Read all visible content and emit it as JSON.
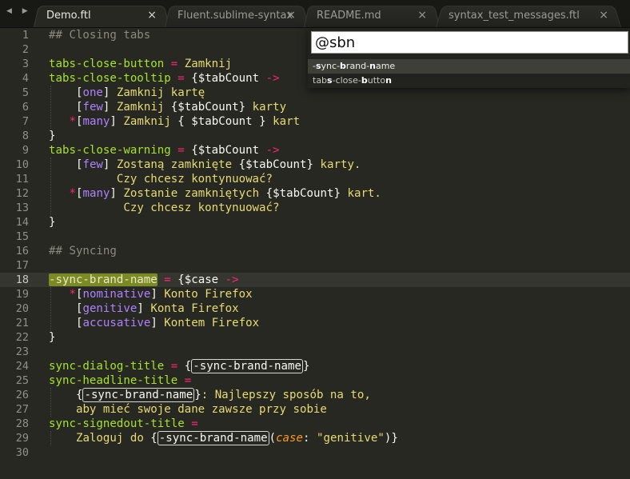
{
  "nav": {
    "arrows": "◀ ▶"
  },
  "tabs": [
    {
      "label": "Demo.ftl",
      "close": "×",
      "active": true
    },
    {
      "label": "Fluent.sublime-syntax",
      "close": "×",
      "active": false
    },
    {
      "label": "README.md",
      "close": "×",
      "active": false
    },
    {
      "label": "syntax_test_messages.ftl",
      "close": "×",
      "active": false
    }
  ],
  "editor": {
    "current_line": 18,
    "line_numbers": [
      "1",
      "2",
      "3",
      "4",
      "5",
      "6",
      "7",
      "8",
      "9",
      "10",
      "11",
      "12",
      "13",
      "14",
      "15",
      "16",
      "17",
      "18",
      "19",
      "20",
      "21",
      "22",
      "23",
      "24",
      "25",
      "26",
      "27",
      "28",
      "29",
      "30"
    ],
    "lines": [
      [
        [
          "c-com",
          "## Closing tabs"
        ]
      ],
      [],
      [
        [
          "c-id",
          "tabs-close-button"
        ],
        [
          "c-op",
          " = "
        ],
        [
          "c-str",
          "Zamknij"
        ]
      ],
      [
        [
          "c-id",
          "tabs-close-tooltip"
        ],
        [
          "c-op",
          " = "
        ],
        [
          "c-br",
          "{"
        ],
        [
          "c-var",
          "$tabCount"
        ],
        [
          "c-op",
          " ->"
        ]
      ],
      [
        [
          "",
          "    "
        ],
        [
          "c-br",
          "["
        ],
        [
          "c-key",
          "one"
        ],
        [
          "c-br",
          "]"
        ],
        [
          "c-str",
          " Zamknij kartę"
        ]
      ],
      [
        [
          "",
          "    "
        ],
        [
          "c-br",
          "["
        ],
        [
          "c-key",
          "few"
        ],
        [
          "c-br",
          "]"
        ],
        [
          "c-str",
          " Zamknij "
        ],
        [
          "c-br",
          "{"
        ],
        [
          "c-var",
          "$tabCount"
        ],
        [
          "c-br",
          "}"
        ],
        [
          "c-str",
          " karty"
        ]
      ],
      [
        [
          "",
          "   "
        ],
        [
          "c-op",
          "*"
        ],
        [
          "c-br",
          "["
        ],
        [
          "c-key",
          "many"
        ],
        [
          "c-br",
          "]"
        ],
        [
          "c-str",
          " Zamknij "
        ],
        [
          "c-br",
          "{ "
        ],
        [
          "c-var",
          "$tabCount"
        ],
        [
          "c-br",
          " }"
        ],
        [
          "c-str",
          " kart"
        ]
      ],
      [
        [
          "c-br",
          "}"
        ]
      ],
      [
        [
          "c-id",
          "tabs-close-warning"
        ],
        [
          "c-op",
          " = "
        ],
        [
          "c-br",
          "{"
        ],
        [
          "c-var",
          "$tabCount"
        ],
        [
          "c-op",
          " ->"
        ]
      ],
      [
        [
          "",
          "    "
        ],
        [
          "c-br",
          "["
        ],
        [
          "c-key",
          "few"
        ],
        [
          "c-br",
          "]"
        ],
        [
          "c-str",
          " Zostaną zamknięte "
        ],
        [
          "c-br",
          "{"
        ],
        [
          "c-var",
          "$tabCount"
        ],
        [
          "c-br",
          "}"
        ],
        [
          "c-str",
          " karty."
        ]
      ],
      [
        [
          "",
          "          "
        ],
        [
          "c-str",
          "Czy chcesz kontynuować?"
        ]
      ],
      [
        [
          "",
          "   "
        ],
        [
          "c-op",
          "*"
        ],
        [
          "c-br",
          "["
        ],
        [
          "c-key",
          "many"
        ],
        [
          "c-br",
          "]"
        ],
        [
          "c-str",
          " Zostanie zamkniętych "
        ],
        [
          "c-br",
          "{"
        ],
        [
          "c-var",
          "$tabCount"
        ],
        [
          "c-br",
          "}"
        ],
        [
          "c-str",
          " kart."
        ]
      ],
      [
        [
          "",
          "           "
        ],
        [
          "c-str",
          "Czy chcesz kontynuować?"
        ]
      ],
      [
        [
          "c-br",
          "}"
        ]
      ],
      [],
      [
        [
          "c-com",
          "## Syncing"
        ]
      ],
      [],
      [
        [
          "hl",
          "-sync-brand-name"
        ],
        [
          "c-op",
          " = "
        ],
        [
          "c-br",
          "{"
        ],
        [
          "c-var",
          "$case"
        ],
        [
          "c-op",
          " ->"
        ]
      ],
      [
        [
          "",
          "   "
        ],
        [
          "c-op",
          "*"
        ],
        [
          "c-br",
          "["
        ],
        [
          "c-key",
          "nominative"
        ],
        [
          "c-br",
          "]"
        ],
        [
          "c-str",
          " Konto Firefox"
        ]
      ],
      [
        [
          "",
          "    "
        ],
        [
          "c-br",
          "["
        ],
        [
          "c-key",
          "genitive"
        ],
        [
          "c-br",
          "]"
        ],
        [
          "c-str",
          " Konta Firefox"
        ]
      ],
      [
        [
          "",
          "    "
        ],
        [
          "c-br",
          "["
        ],
        [
          "c-key",
          "accusative"
        ],
        [
          "c-br",
          "]"
        ],
        [
          "c-str",
          " Kontem Firefox"
        ]
      ],
      [
        [
          "c-br",
          "}"
        ]
      ],
      [],
      [
        [
          "c-id",
          "sync-dialog-title"
        ],
        [
          "c-op",
          " = "
        ],
        [
          "c-br",
          "{"
        ],
        [
          "box",
          "-sync-brand-name"
        ],
        [
          "c-br",
          "}"
        ]
      ],
      [
        [
          "c-id",
          "sync-headline-title"
        ],
        [
          "c-op",
          " ="
        ]
      ],
      [
        [
          "",
          "    "
        ],
        [
          "c-br",
          "{"
        ],
        [
          "box",
          "-sync-brand-name"
        ],
        [
          "c-br",
          "}"
        ],
        [
          "c-str",
          ": Najlepszy sposób na to,"
        ]
      ],
      [
        [
          "",
          "    "
        ],
        [
          "c-str",
          "aby mieć swoje dane zawsze przy sobie"
        ]
      ],
      [
        [
          "c-id",
          "sync-signedout-title"
        ],
        [
          "c-op",
          " ="
        ]
      ],
      [
        [
          "",
          "    "
        ],
        [
          "c-str",
          "Zaloguj do "
        ],
        [
          "c-br",
          "{"
        ],
        [
          "box",
          "-sync-brand-name"
        ],
        [
          "c-br",
          "("
        ],
        [
          "c-arg",
          "case"
        ],
        [
          "c-br",
          ": "
        ],
        [
          "c-str",
          "\"genitive\""
        ],
        [
          "c-br",
          ")}"
        ]
      ],
      []
    ]
  },
  "palette": {
    "query": "@sbn",
    "results": [
      {
        "parts": [
          [
            "",
            "-"
          ],
          [
            "b",
            "s"
          ],
          [
            "",
            "ync-"
          ],
          [
            "b",
            "b"
          ],
          [
            "",
            "rand-"
          ],
          [
            "b",
            "n"
          ],
          [
            "",
            "ame"
          ]
        ],
        "selected": true
      },
      {
        "parts": [
          [
            "",
            "tab"
          ],
          [
            "b",
            "s"
          ],
          [
            "",
            "-close-"
          ],
          [
            "b",
            "b"
          ],
          [
            "",
            "utto"
          ],
          [
            "b",
            "n"
          ]
        ],
        "selected": false
      }
    ]
  },
  "colors": {
    "background": "#272822",
    "comment": "#8a8a80",
    "identifier": "#a6e22e",
    "operator": "#f92672",
    "string": "#e6db74",
    "keyword": "#ae81ff",
    "argument": "#fd971f",
    "highlight": "#7b8a22"
  }
}
